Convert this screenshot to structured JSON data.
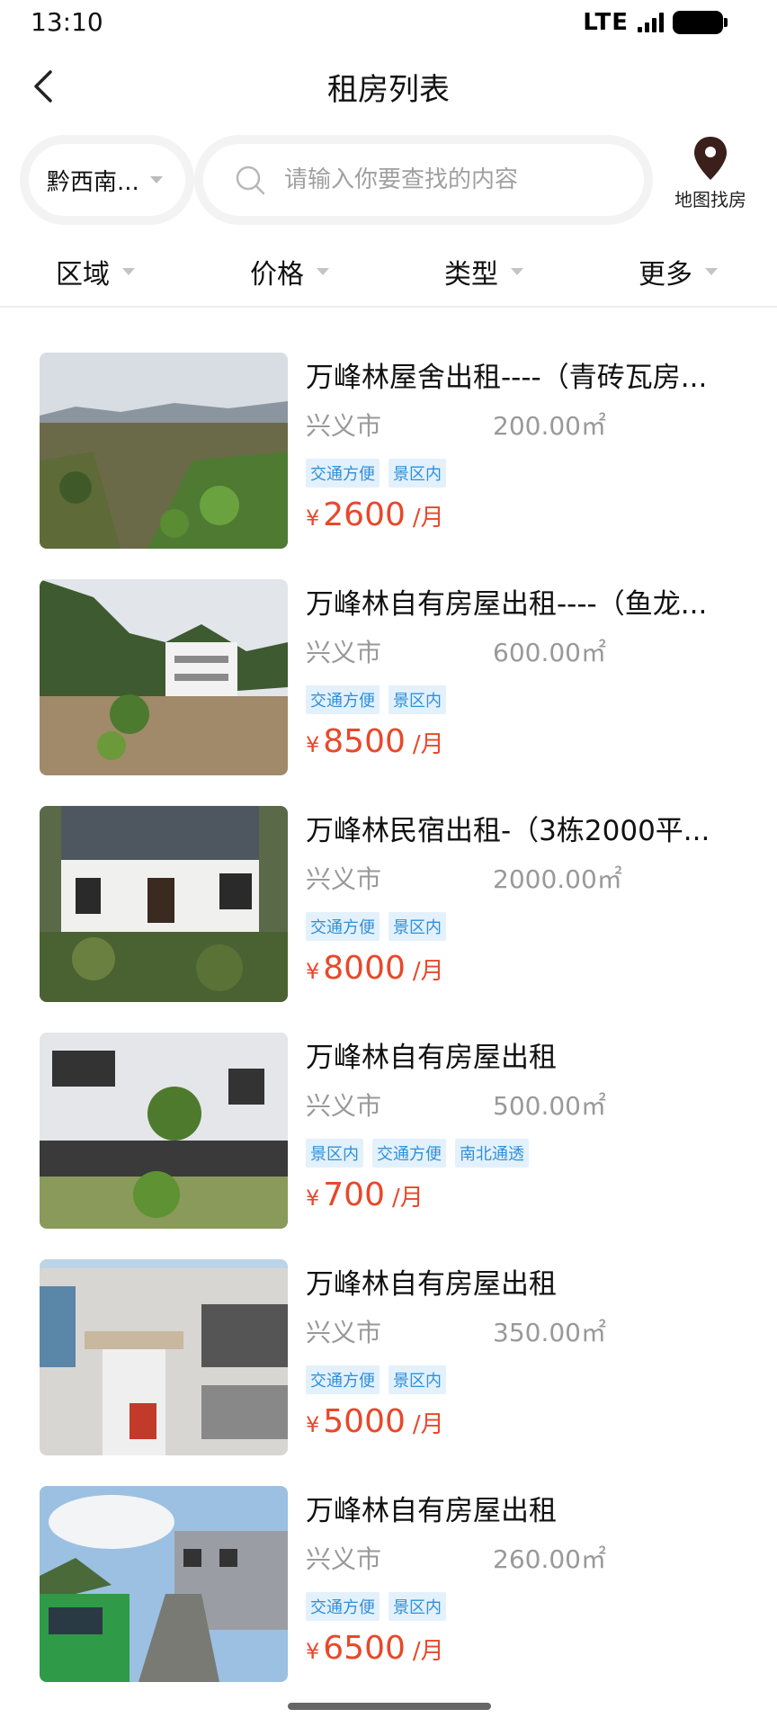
{
  "status_bar": {
    "time": "13:10",
    "network": "LTE"
  },
  "header": {
    "title": "租房列表"
  },
  "search": {
    "city": "黔西南...",
    "placeholder": "请输入你要查找的内容",
    "map_label": "地图找房"
  },
  "filters": [
    "区域",
    "价格",
    "类型",
    "更多"
  ],
  "listings": [
    {
      "title": "万峰林屋舍出租----（青砖瓦房...",
      "city": "兴义市",
      "area": "200.00㎡",
      "tags": [
        "交通方便",
        "景区内"
      ],
      "currency": "¥",
      "price": "2600",
      "unit": "/月"
    },
    {
      "title": "万峰林自有房屋出租----（鱼龙...",
      "city": "兴义市",
      "area": "600.00㎡",
      "tags": [
        "交通方便",
        "景区内"
      ],
      "currency": "¥",
      "price": "8500",
      "unit": "/月"
    },
    {
      "title": "万峰林民宿出租-（3栋2000平...",
      "city": "兴义市",
      "area": "2000.00㎡",
      "tags": [
        "交通方便",
        "景区内"
      ],
      "currency": "¥",
      "price": "8000",
      "unit": "/月"
    },
    {
      "title": "万峰林自有房屋出租",
      "city": "兴义市",
      "area": "500.00㎡",
      "tags": [
        "景区内",
        "交通方便",
        "南北通透"
      ],
      "currency": "¥",
      "price": "700",
      "unit": "/月"
    },
    {
      "title": "万峰林自有房屋出租",
      "city": "兴义市",
      "area": "350.00㎡",
      "tags": [
        "交通方便",
        "景区内"
      ],
      "currency": "¥",
      "price": "5000",
      "unit": "/月"
    },
    {
      "title": "万峰林自有房屋出租",
      "city": "兴义市",
      "area": "260.00㎡",
      "tags": [
        "交通方便",
        "景区内"
      ],
      "currency": "¥",
      "price": "6500",
      "unit": "/月"
    }
  ],
  "colors": {
    "price": "#e8482a",
    "tag_text": "#2f8fd8",
    "tag_bg": "#e3f1fc",
    "map_pin": "#3a1f1a"
  }
}
